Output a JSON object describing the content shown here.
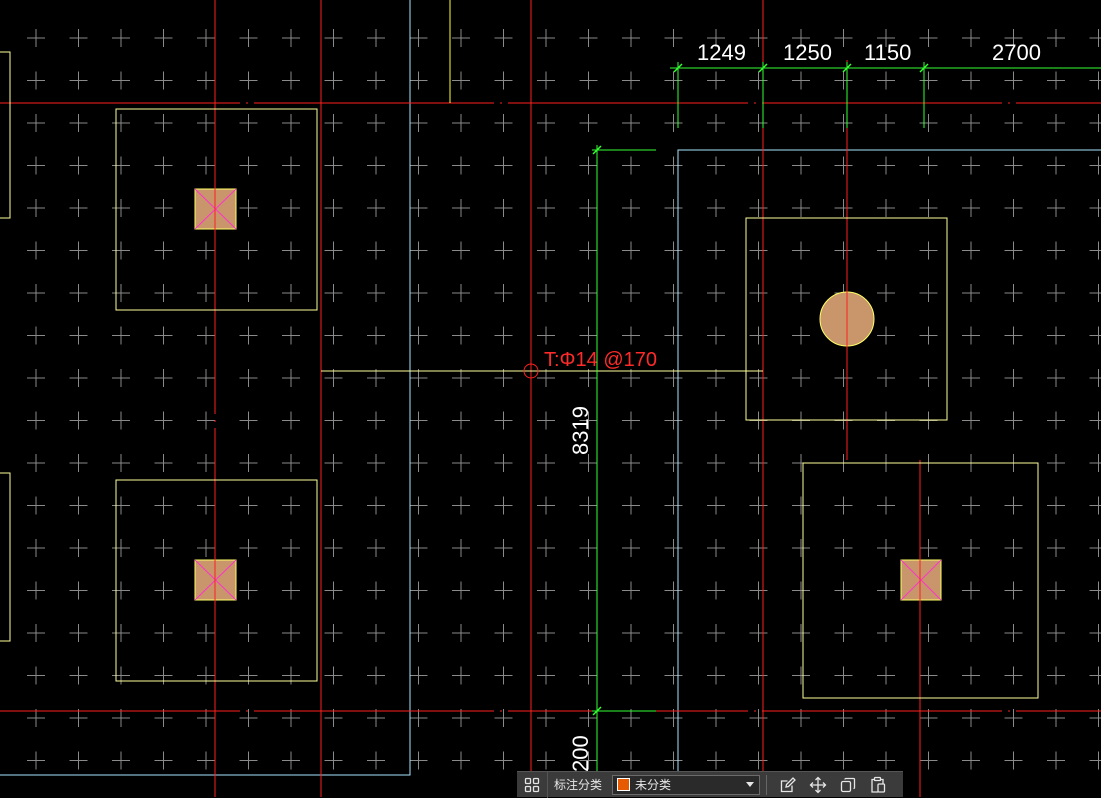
{
  "drawing": {
    "dimensions_top": [
      "1249",
      "1250",
      "1150",
      "2700"
    ],
    "dimension_vertical": "8319",
    "dimension_bottom": "200",
    "rebar_annotation": "T:Φ14 @170"
  },
  "toolbar": {
    "label": "标注分类",
    "category_value": "未分类",
    "icons": [
      "grid-view-icon",
      "edit-icon",
      "move-icon",
      "copy-icon",
      "paste-icon"
    ]
  },
  "colors": {
    "background": "#000000",
    "axis_red": "#ff2020",
    "outline_yellow": "#ffff99",
    "outline_cyan": "#a8e6ff",
    "dimension_green": "#33ff33",
    "column_fill": "#c8966a",
    "cross_magenta": "#ff33cc"
  }
}
